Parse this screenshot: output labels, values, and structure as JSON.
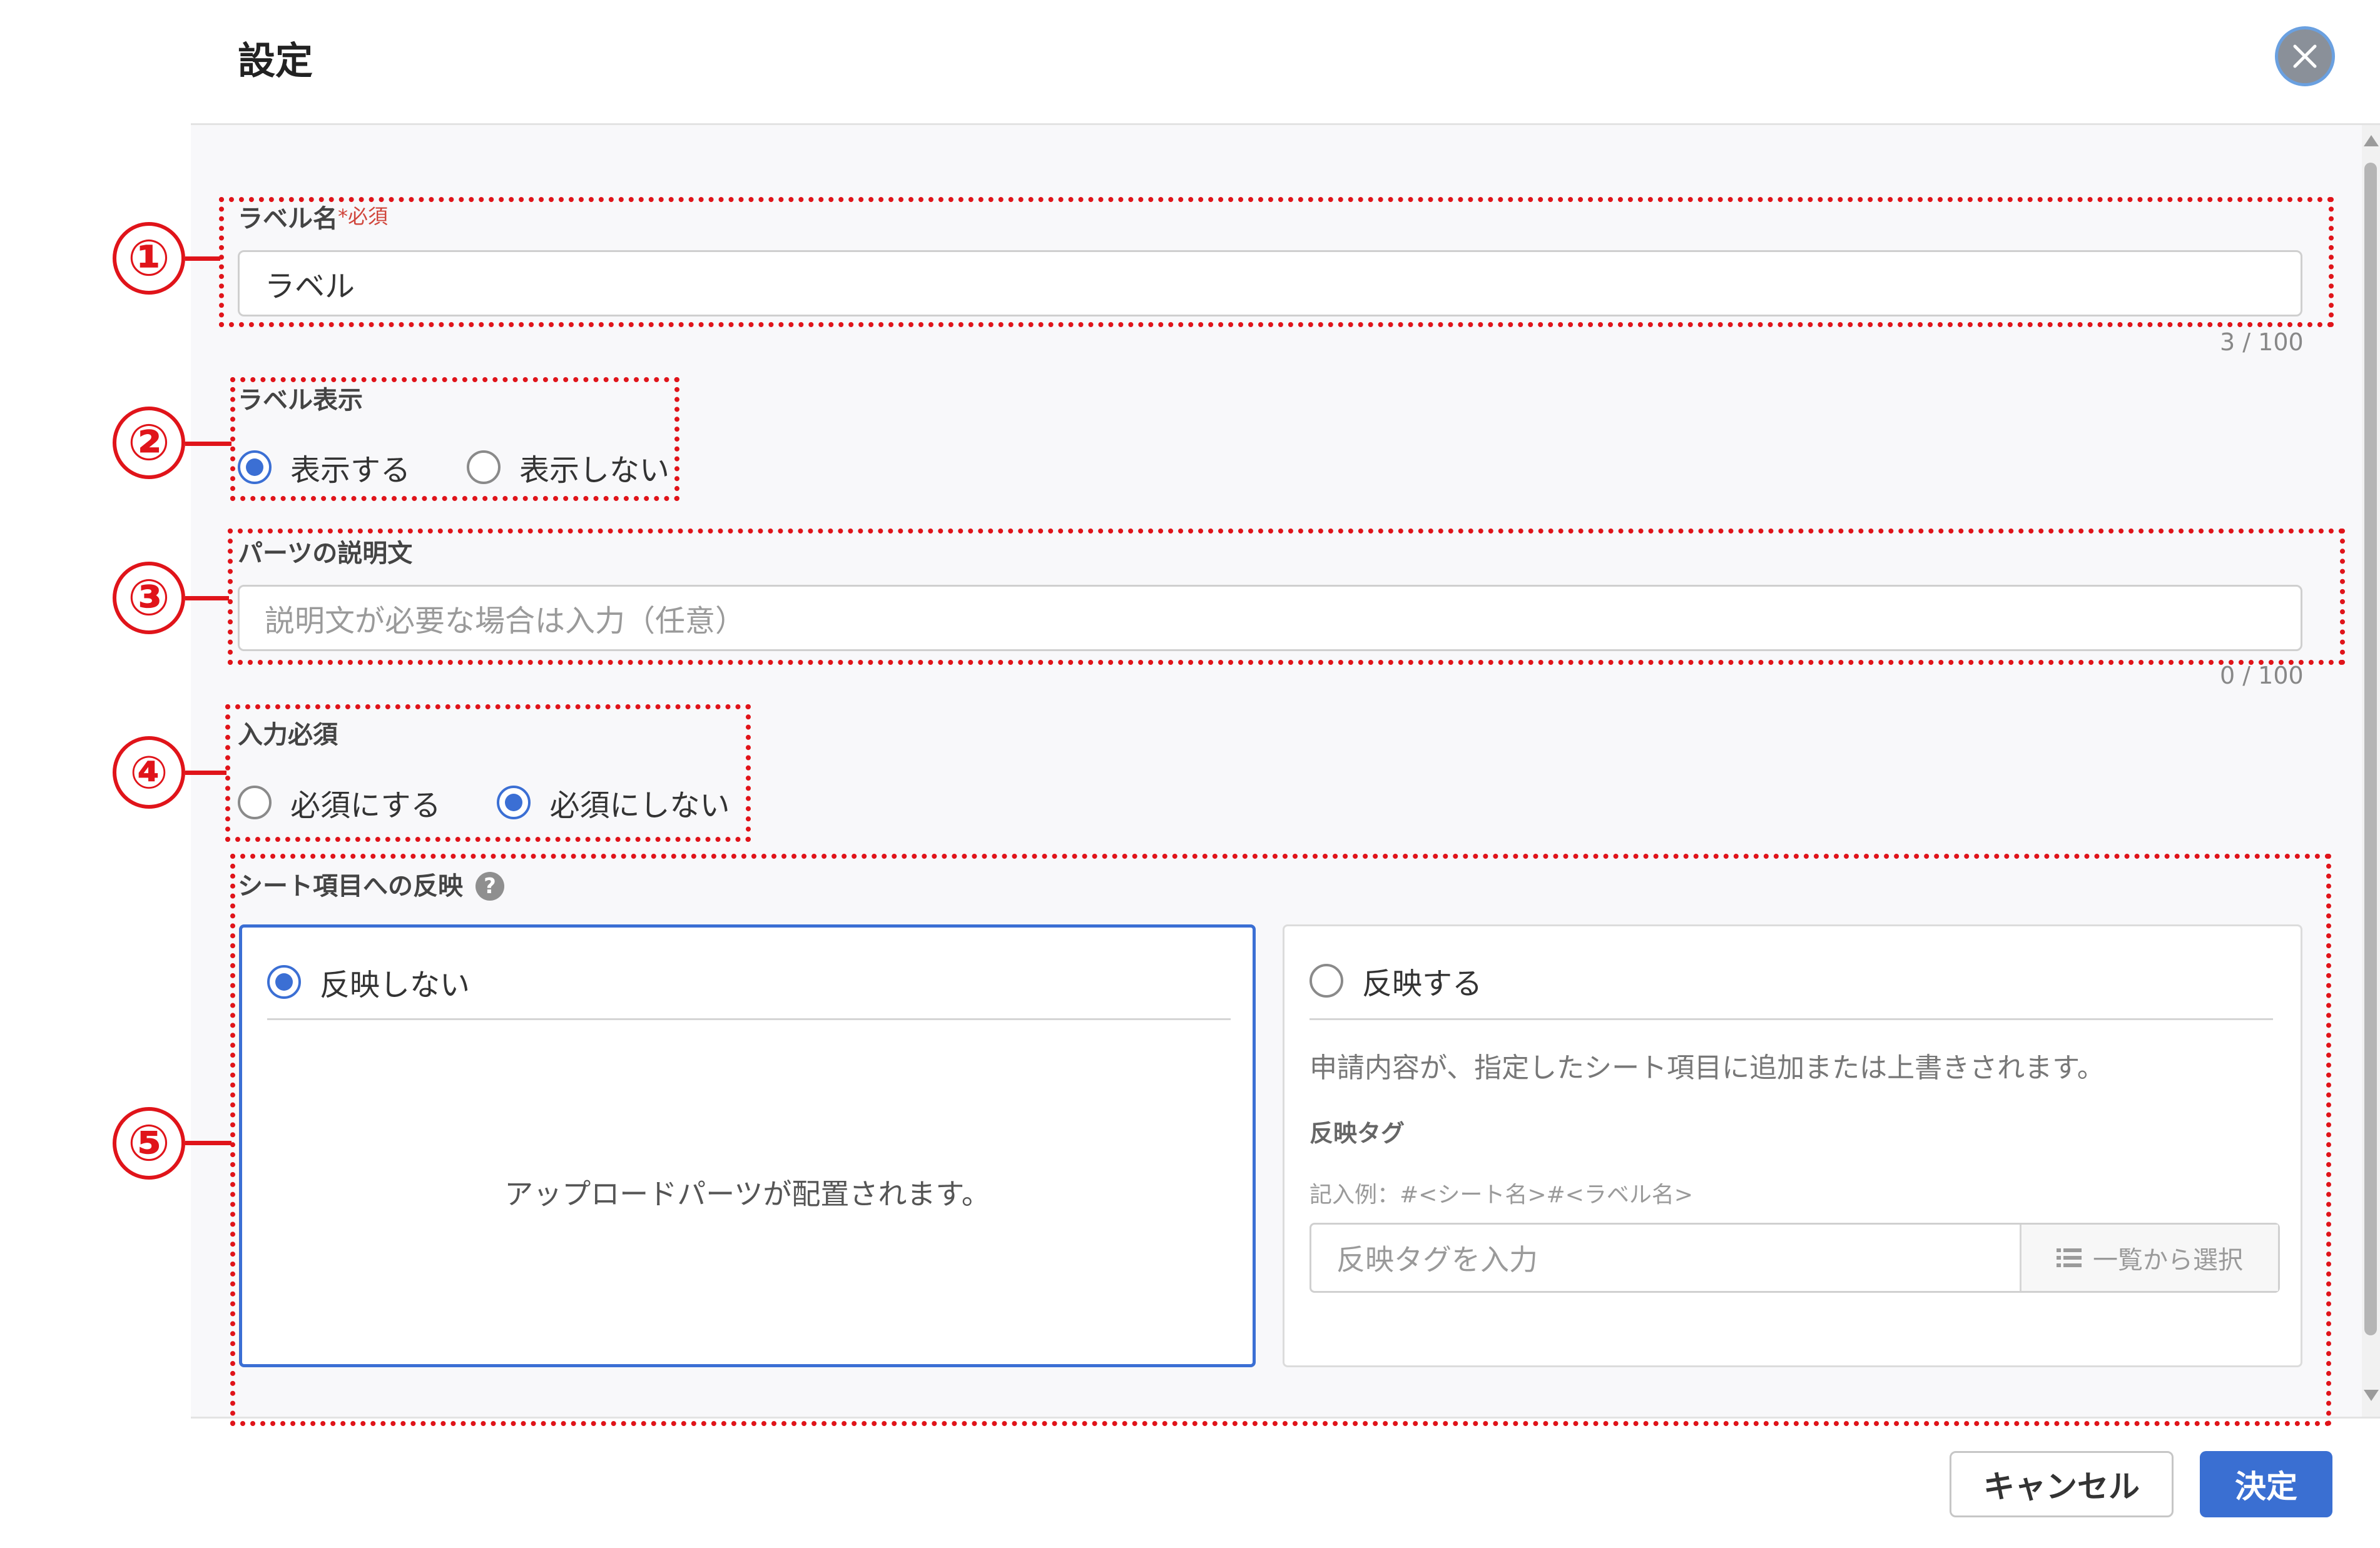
{
  "dialog": {
    "title": "設定"
  },
  "label_name": {
    "label": "ラベル名",
    "required_mark": "*必須",
    "value": "ラベル",
    "counter": "3 / 100"
  },
  "label_display": {
    "label": "ラベル表示",
    "options": [
      "表示する",
      "表示しない"
    ],
    "selected": "表示する"
  },
  "description": {
    "label": "パーツの説明文",
    "placeholder": "説明文が必要な場合は入力（任意）",
    "counter": "0 / 100"
  },
  "input_required": {
    "label": "入力必須",
    "options": [
      "必須にする",
      "必須にしない"
    ],
    "selected": "必須にしない"
  },
  "sheet_reflect": {
    "label": "シート項目への反映",
    "no_reflect": {
      "label": "反映しない",
      "body": "アップロードパーツが配置されます。",
      "selected": true
    },
    "reflect": {
      "label": "反映する",
      "description": "申請内容が、指定したシート項目に追加または上書きされます。",
      "tag_label": "反映タグ",
      "example": "記入例：#<シート名>#<ラベル名>",
      "tag_placeholder": "反映タグを入力",
      "select_button": "一覧から選択",
      "selected": false
    }
  },
  "annotations": [
    "①",
    "②",
    "③",
    "④",
    "⑤"
  ],
  "footer": {
    "cancel": "キャンセル",
    "ok": "決定"
  },
  "colors": {
    "accent": "#3a6fd2",
    "annotation": "#e0141a"
  }
}
